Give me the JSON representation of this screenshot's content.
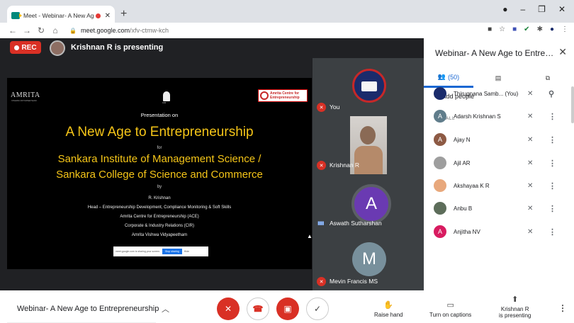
{
  "browser": {
    "tab_title": "Meet - Webinar- A New Age",
    "tab_close": "✕",
    "new_tab": "+",
    "url_host": "meet.google.com",
    "url_path": "/xfv-ctmw-kch",
    "controls": {
      "minimize": "–",
      "maximize": "❐",
      "close": "✕"
    }
  },
  "stage": {
    "rec_label": "REC",
    "presenting_label": "Krishnan R is presenting"
  },
  "slide": {
    "org_left": "AMRITA",
    "org_left_sub": "VISHWA VIDYAPEETHAM",
    "cir_label": "CIR",
    "ace_label_line1": "Amrita Centre for",
    "ace_label_line2": "Entrepreneurship",
    "presentation_on": "Presentation on",
    "title": "A New Age to Entrepreneurship",
    "for": "for",
    "institute_line1": "Sankara Institute of Management Science /",
    "institute_line2": "Sankara College of Science and Commerce",
    "by": "by",
    "presenter": "R. Krishnan",
    "role": "Head – Entrepreneurship Development, Compliance Monitoring & Soft Skills",
    "center": "Amrita Centre for Entrepreneurship (ACE)",
    "cir": "Corporate & Industry Relations (CIR)",
    "university": "Amrita Vishwa Vidyapeetham",
    "share_text": "meet.google.com is sharing your screen.",
    "share_stop": "Stop sharing",
    "share_hide": "Hide"
  },
  "tiles": [
    {
      "name": "You"
    },
    {
      "name": "Krishnan R"
    },
    {
      "name": "Aswath Sutharshan",
      "initial": "A"
    },
    {
      "name": "Mevin Francis MS",
      "initial": "M"
    }
  ],
  "panel": {
    "title": "Webinar- A New Age to Entrepre...",
    "people_count": "(50)",
    "add_people": "Add people",
    "in_call": "IN CALL",
    "participants": [
      {
        "name": "Thirugnana Samb... (You)",
        "initial": "",
        "color": "#1a2b6b"
      },
      {
        "name": "Adarsh Krishnan S",
        "initial": "A",
        "color": "#607d8b"
      },
      {
        "name": "Ajay N",
        "initial": "A",
        "color": "#8d5a44"
      },
      {
        "name": "Ajil AR",
        "initial": "",
        "color": "#9e9e9e"
      },
      {
        "name": "Akshayaa K R",
        "initial": "",
        "color": "#e8a87c"
      },
      {
        "name": "Anbu B",
        "initial": "",
        "color": "#5d6d5a"
      },
      {
        "name": "Anjitha NV",
        "initial": "A",
        "color": "#d81b60"
      }
    ]
  },
  "bottom": {
    "meeting_name": "Webinar- A New Age to Entrepreneurship",
    "raise_hand": "Raise hand",
    "captions": "Turn on captions",
    "presenting_line1": "Krishnan R",
    "presenting_line2": "is presenting"
  }
}
